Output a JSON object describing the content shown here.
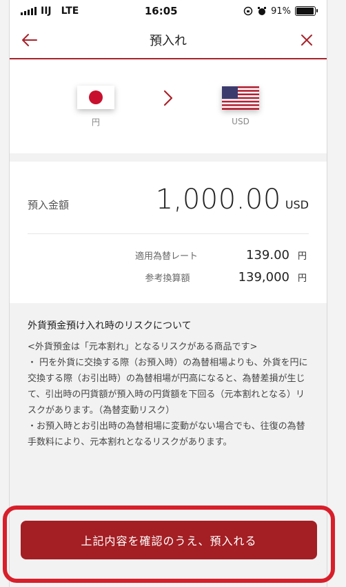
{
  "status_bar": {
    "carrier": "IIJ",
    "network": "LTE",
    "time": "16:05",
    "battery": "91%"
  },
  "header": {
    "title": "預入れ",
    "back_icon": "back-arrow-icon",
    "close_icon": "close-icon"
  },
  "currency_pair": {
    "from_label": "円",
    "to_label": "USD",
    "arrow_icon": "chevron-right-icon"
  },
  "deposit": {
    "label": "預入金額",
    "amount": "1,000.00",
    "unit": "USD"
  },
  "rates": [
    {
      "label": "適用為替レート",
      "value": "139.00",
      "unit": "円"
    },
    {
      "label": "参考換算額",
      "value": "139,000",
      "unit": "円"
    }
  ],
  "risk": {
    "title": "外貨預金預け入れ時のリスクについて",
    "text": "<外貨預金は「元本割れ」となるリスクがある商品です>\n・ 円を外貨に交換する際（お預入時）の為替相場よりも、外貨を円に交換する際（お引出時）の為替相場が円高になると、為替差損が生じて、引出時の円貨額が預入時の円貨額を下回る（元本割れとなる）リスクがあります。（為替変動リスク）\n・お預入時とお引出時の為替相場に変動がない場合でも、往復の為替手数料により、元本割れとなるリスクがあります。"
  },
  "confirm_button": {
    "label": "上記内容を確認のうえ、預入れる"
  },
  "colors": {
    "brand": "#a31f24",
    "highlight": "#d81f2a"
  }
}
